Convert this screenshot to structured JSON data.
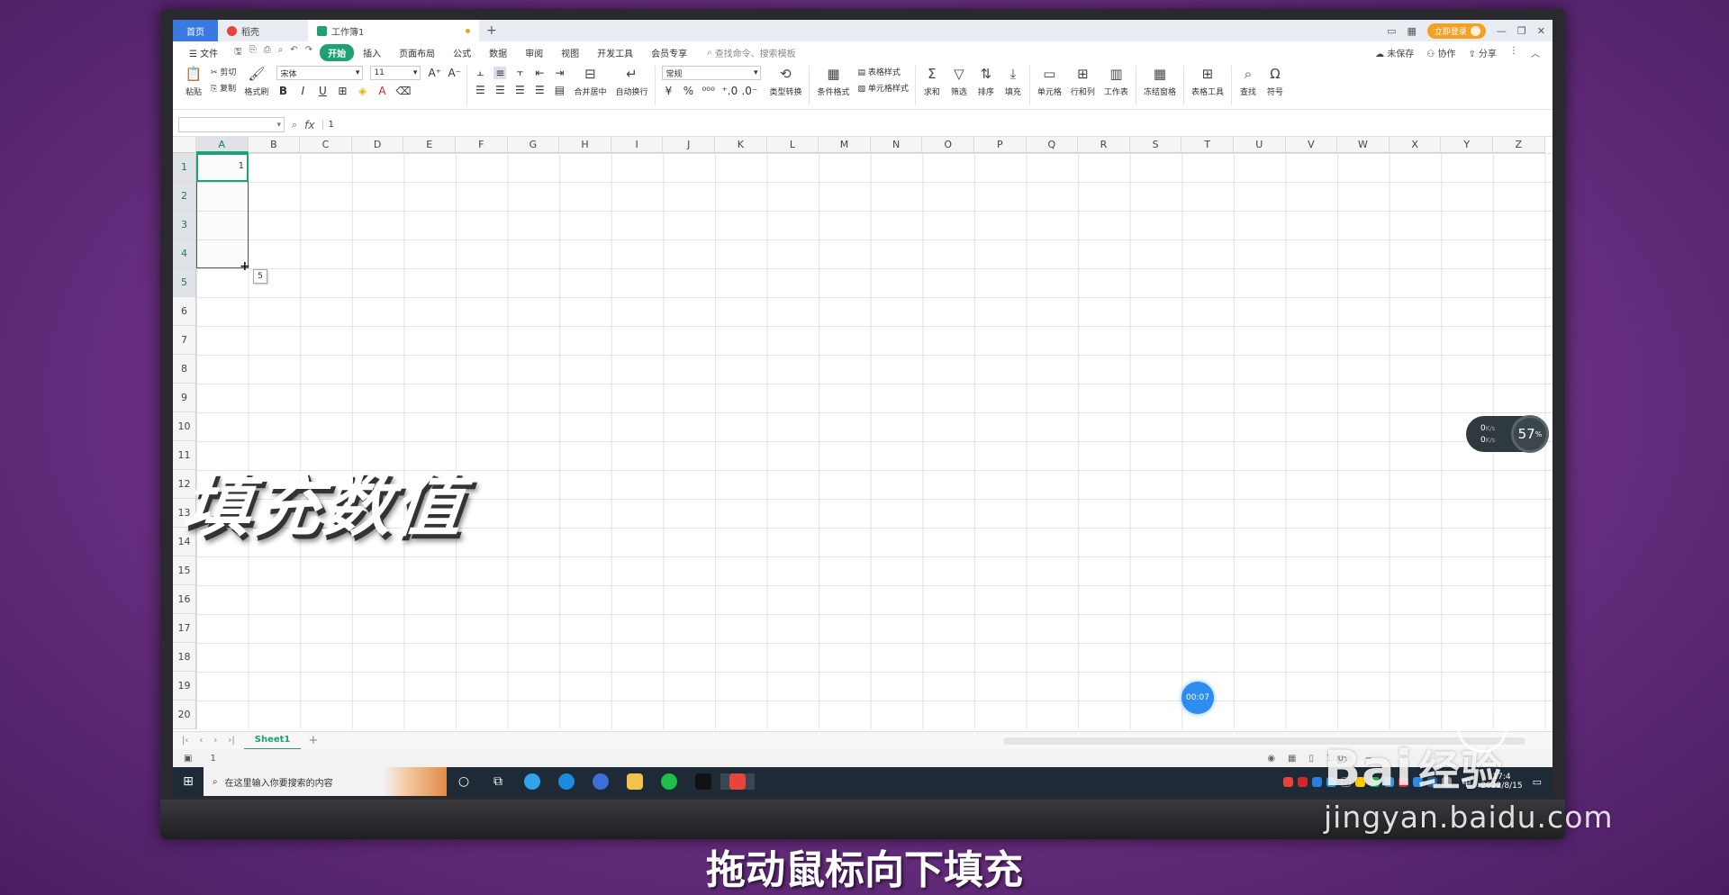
{
  "tabbar": {
    "home": "首页",
    "docer": "稻壳",
    "workbook": "工作簿1",
    "new_tab": "+",
    "login": "立即登录"
  },
  "menu": {
    "file": "文件",
    "items": [
      "开始",
      "插入",
      "页面布局",
      "公式",
      "数据",
      "审阅",
      "视图",
      "开发工具",
      "会员专享"
    ],
    "search": "查找命令、搜索模板",
    "unsaved": "未保存",
    "collab": "协作",
    "share": "分享"
  },
  "ribbon": {
    "paste": "粘贴",
    "cut": "剪切",
    "copy": "复制",
    "format_painter": "格式刷",
    "font": "宋体",
    "size": "11",
    "merge": "合并居中",
    "wrap": "自动换行",
    "numfmt": "常规",
    "convert": "类型转换",
    "cond_fmt": "条件格式",
    "table_style": "表格样式",
    "cell_style": "单元格样式",
    "sum": "求和",
    "filter": "筛选",
    "sort": "排序",
    "fill": "填充",
    "cell": "单元格",
    "rowcol": "行和列",
    "worksheet": "工作表",
    "freeze": "冻结窗格",
    "table_tools": "表格工具",
    "find": "查找",
    "symbol": "符号"
  },
  "formula": {
    "fx": "fx",
    "value": "1"
  },
  "grid": {
    "columns": [
      "A",
      "B",
      "C",
      "D",
      "E",
      "F",
      "G",
      "H",
      "I",
      "J",
      "K",
      "L",
      "M",
      "N",
      "O",
      "P",
      "Q",
      "R",
      "S",
      "T",
      "U",
      "V",
      "W",
      "X",
      "Y",
      "Z"
    ],
    "rows": [
      "1",
      "2",
      "3",
      "4",
      "5",
      "6",
      "7",
      "8",
      "9",
      "10",
      "11",
      "12",
      "13",
      "14",
      "15",
      "16",
      "17",
      "18",
      "19",
      "20"
    ],
    "a1_value": "1",
    "fill_tip": "5"
  },
  "speed": {
    "up": "0",
    "down": "0",
    "unit": "K/s",
    "percent": "57",
    "percent_sign": "%"
  },
  "timer": "00:07",
  "sheet": {
    "name": "Sheet1",
    "add": "+"
  },
  "status": {
    "left": "1",
    "zoom": "100%"
  },
  "taskbar": {
    "search": "在这里输入你要搜索的内容",
    "time": "17:4",
    "date": "2022/8/15",
    "ime": "中"
  },
  "overlay": {
    "title": "填充数值",
    "caption": "拖动鼠标向下填充"
  },
  "watermark": {
    "logo": "Bai",
    "logo_cn": "经验",
    "url": "jingyan.baidu.com"
  },
  "colors": {
    "accent": "#1fa173",
    "tab_blue": "#3a7ae0",
    "login": "#f3a125"
  }
}
